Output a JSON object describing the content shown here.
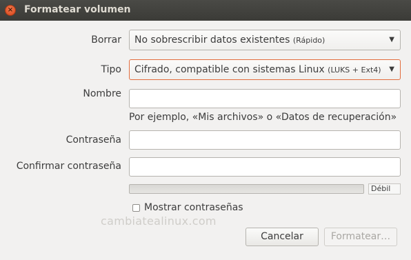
{
  "window": {
    "title": "Formatear volumen",
    "close_symbol": "×"
  },
  "form": {
    "borrar": {
      "label": "Borrar",
      "value_main": "No sobrescribir datos existentes ",
      "value_small": "(Rápido)",
      "arrow": "▼"
    },
    "tipo": {
      "label": "Tipo",
      "value_main": "Cifrado, compatible con sistemas Linux ",
      "value_small": "(LUKS + Ext4)",
      "arrow": "▼"
    },
    "nombre": {
      "label": "Nombre",
      "value": "",
      "hint": "Por ejemplo, «Mis archivos» o «Datos de recuperación»"
    },
    "contrasena": {
      "label": "Contraseña",
      "value": ""
    },
    "confirmar": {
      "label": "Confirmar contraseña",
      "value": ""
    },
    "strength": {
      "label": "Débil",
      "level": 0
    },
    "show_passwords": {
      "label": "Mostrar contraseñas",
      "checked": false
    }
  },
  "watermark": "cambiatealinux.com",
  "buttons": {
    "cancel": "Cancelar",
    "format": "Formatear…"
  },
  "colors": {
    "focus_border": "#e26c3d",
    "titlebar": "#3b3b37",
    "close_button": "#e0542a"
  }
}
